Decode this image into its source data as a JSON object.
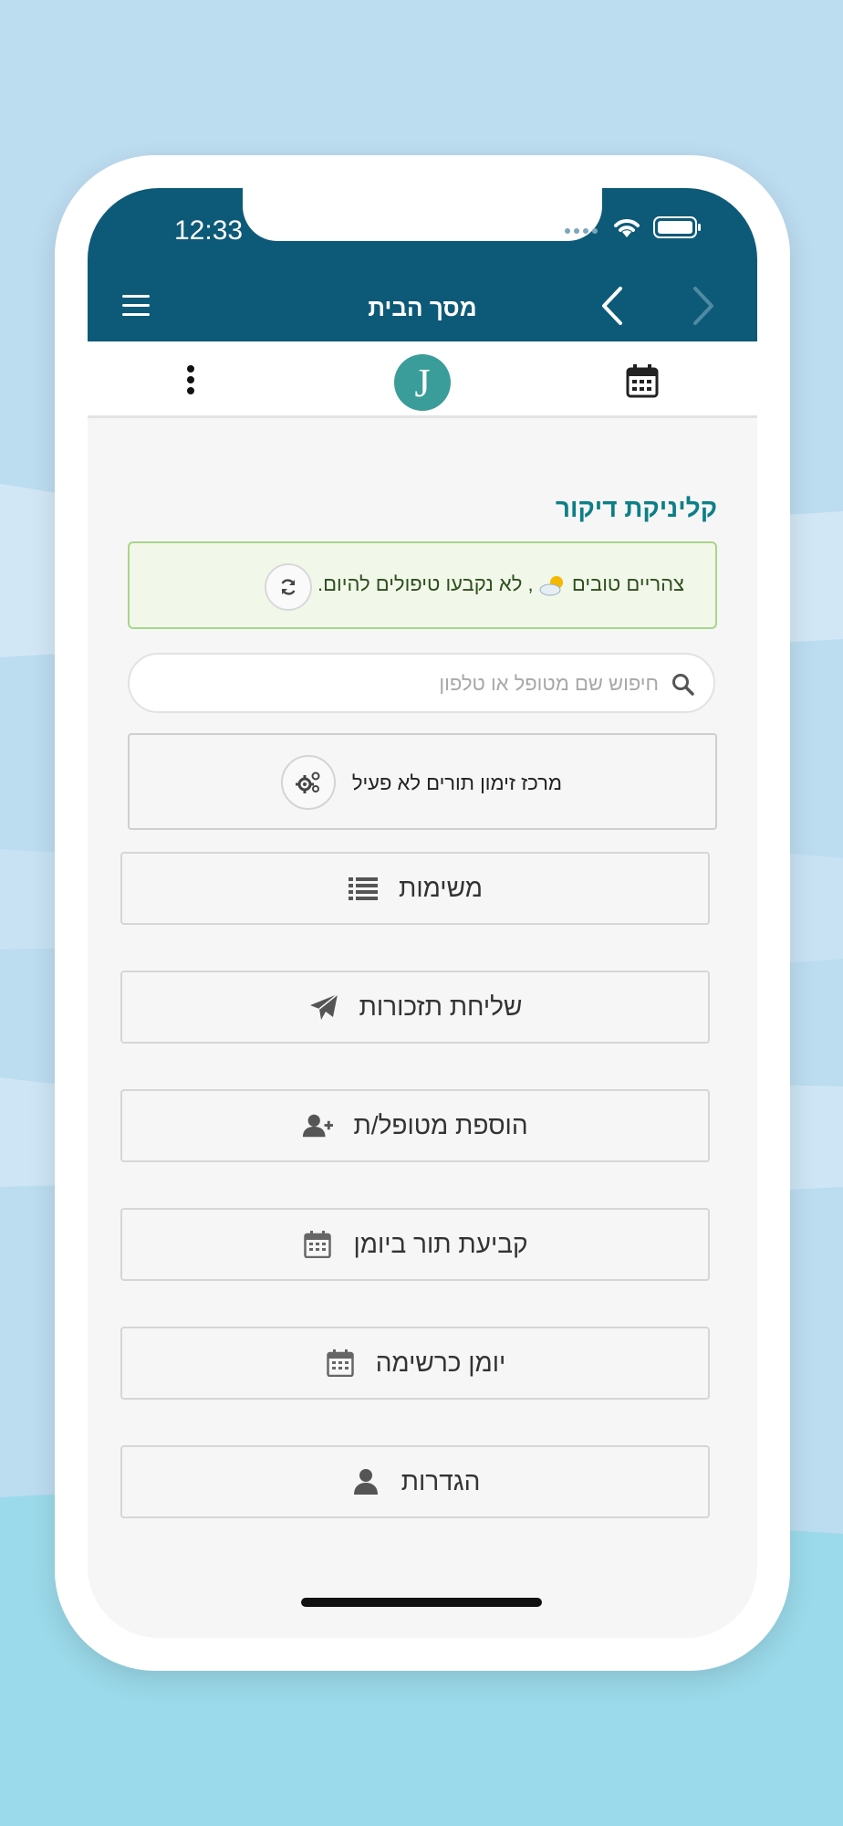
{
  "status_bar": {
    "time": "12:33"
  },
  "header": {
    "title": "מסך הבית",
    "menu_icon": "hamburger-icon",
    "back_icon": "chevron-left-icon",
    "forward_icon": "chevron-right-icon"
  },
  "toolbar": {
    "more_icon": "kebab-icon",
    "avatar_letter": "J",
    "calendar_icon": "calendar-icon"
  },
  "clinic_name": "קליניקת דיקור",
  "greeting": {
    "text_start": "צהריים טובים",
    "text_end": ", לא נקבעו טיפולים להיום.",
    "weather_icon": "sun-cloud-icon",
    "refresh_icon": "refresh-icon"
  },
  "search": {
    "placeholder": "חיפוש שם מטופל או טלפון",
    "value": ""
  },
  "booking_center": {
    "label": "מרכז זימון תורים לא פעיל",
    "icon": "gears-icon"
  },
  "menu": [
    {
      "label": "משימות",
      "icon": "list-icon"
    },
    {
      "label": "שליחת תזכורות",
      "icon": "paper-plane-icon"
    },
    {
      "label": "הוספת מטופל/ת",
      "icon": "user-plus-icon"
    },
    {
      "label": "קביעת תור ביומן",
      "icon": "calendar-icon"
    },
    {
      "label": "יומן כרשימה",
      "icon": "calendar-icon"
    },
    {
      "label": "הגדרות",
      "icon": "user-icon"
    }
  ],
  "colors": {
    "header": "#0d5a78",
    "accent": "#0d7f86",
    "avatar": "#3a9d9a",
    "greeting_bg": "#f1f8e9",
    "greeting_border": "#a9d58a"
  }
}
